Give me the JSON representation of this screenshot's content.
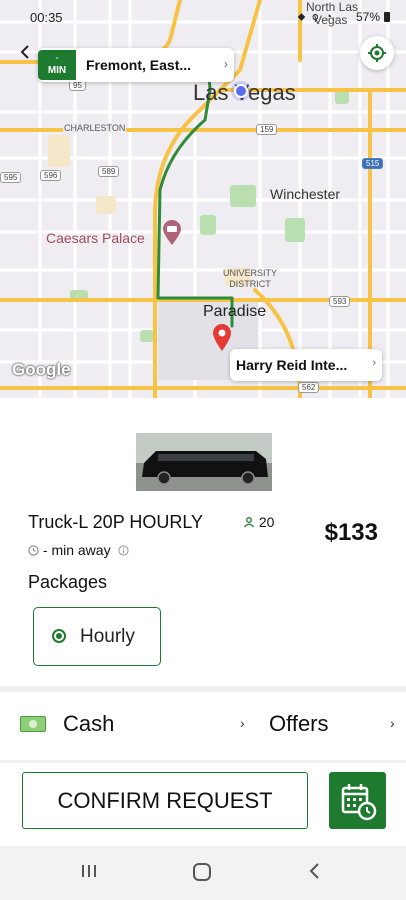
{
  "status_bar": {
    "time": "00:35",
    "battery": "57%"
  },
  "map": {
    "labels": {
      "north_las": "North Las",
      "vegas_partial": "Vegas",
      "las_vegas": "Las Vegas",
      "charleston": "CHARLESTON",
      "winchester": "Winchester",
      "caesars_palace": "Caesars Palace",
      "university_district": "UNIVERSITY DISTRICT",
      "paradise": "Paradise",
      "route_95": "95",
      "route_159": "159",
      "route_595": "595",
      "route_596": "596",
      "route_589": "589",
      "route_515": "515",
      "route_593": "593",
      "route_562": "562"
    },
    "pickup": {
      "eta_value": "-",
      "eta_unit": "MIN",
      "address": "Fremont, East..."
    },
    "dropoff": {
      "address": "Harry Reid Inte..."
    },
    "google_logo": "Google"
  },
  "vehicle": {
    "name": "Truck-L 20P HOURLY",
    "capacity": "20",
    "eta_text": "- min away",
    "price": "$133"
  },
  "packages": {
    "label": "Packages",
    "options": [
      {
        "label": "Hourly",
        "selected": true
      }
    ]
  },
  "payment": {
    "method": "Cash",
    "offers_label": "Offers"
  },
  "actions": {
    "confirm_label": "CONFIRM REQUEST"
  },
  "colors": {
    "brand_green": "#1e7a2f",
    "route_green": "#2e8b3a",
    "pin_red": "#e53935",
    "current_location_blue": "#5b6cf0"
  },
  "icons": {
    "back": "arrow-left-icon",
    "locate": "crosshair-icon",
    "pin": "destination-pin-icon",
    "current": "current-location-dot-icon",
    "hotel": "hotel-icon",
    "capacity": "person-icon",
    "clock": "clock-icon",
    "info": "info-icon",
    "cash": "cash-icon",
    "schedule": "calendar-clock-icon"
  }
}
